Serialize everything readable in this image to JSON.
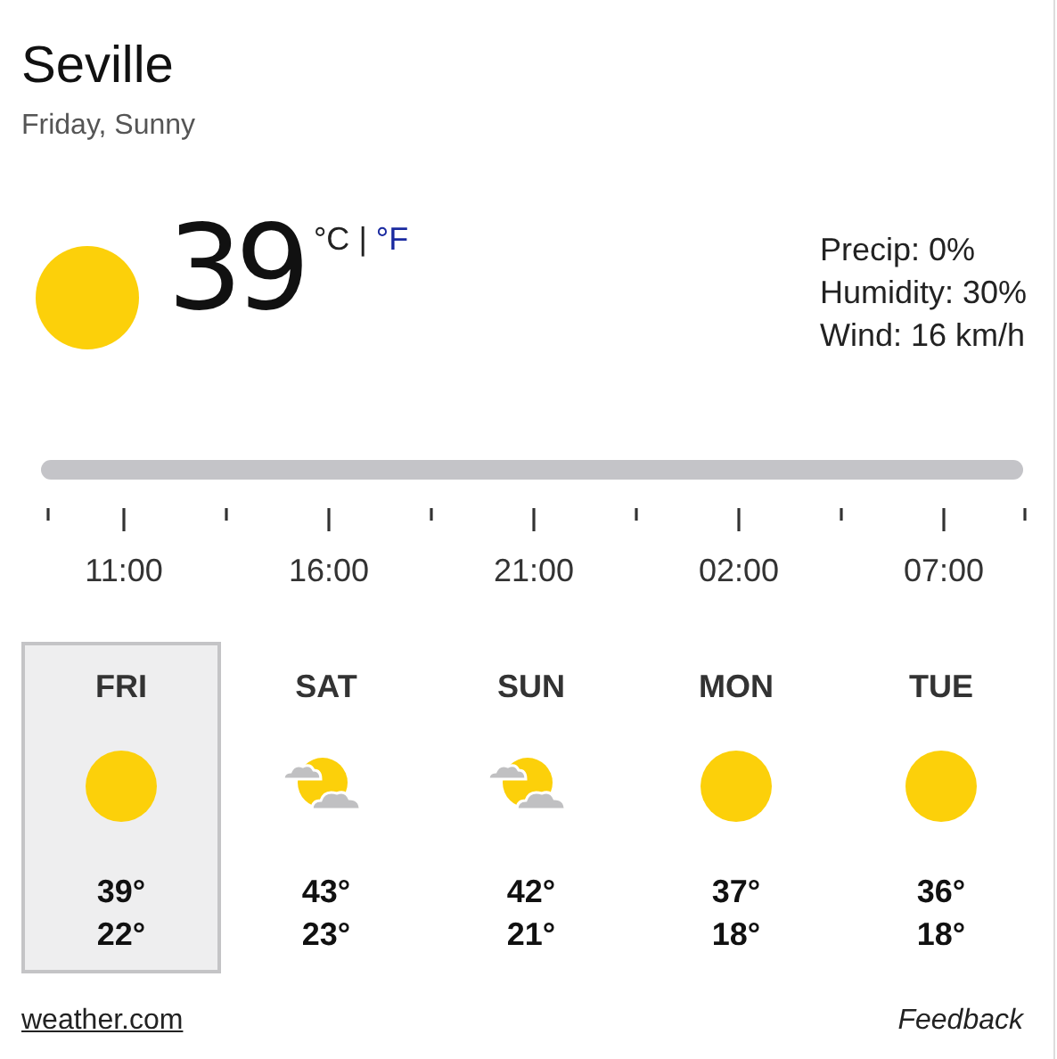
{
  "location": {
    "city": "Seville",
    "subtitle": "Friday, Sunny"
  },
  "current": {
    "kind": "sunny",
    "temperature": "39",
    "units": [
      {
        "label": "°C",
        "selected": true
      },
      {
        "label": "°F",
        "selected": false
      }
    ],
    "separator": "|",
    "details": [
      "Precip: 0%",
      "Humidity: 30%",
      "Wind: 16 km/h"
    ]
  },
  "timeline": {
    "labels": [
      "11:00",
      "16:00",
      "21:00",
      "02:00",
      "07:00"
    ]
  },
  "days": [
    {
      "day": "FRI",
      "kind": "sunny",
      "high": "39°",
      "low": "22°",
      "selected": true
    },
    {
      "day": "SAT",
      "kind": "partly-cloudy",
      "high": "43°",
      "low": "23°",
      "selected": false
    },
    {
      "day": "SUN",
      "kind": "partly-cloudy",
      "high": "42°",
      "low": "21°",
      "selected": false
    },
    {
      "day": "MON",
      "kind": "sunny",
      "high": "37°",
      "low": "18°",
      "selected": false
    },
    {
      "day": "TUE",
      "kind": "sunny",
      "high": "36°",
      "low": "18°",
      "selected": false
    }
  ],
  "footer": {
    "source": "weather.com",
    "feedback": "Feedback"
  }
}
